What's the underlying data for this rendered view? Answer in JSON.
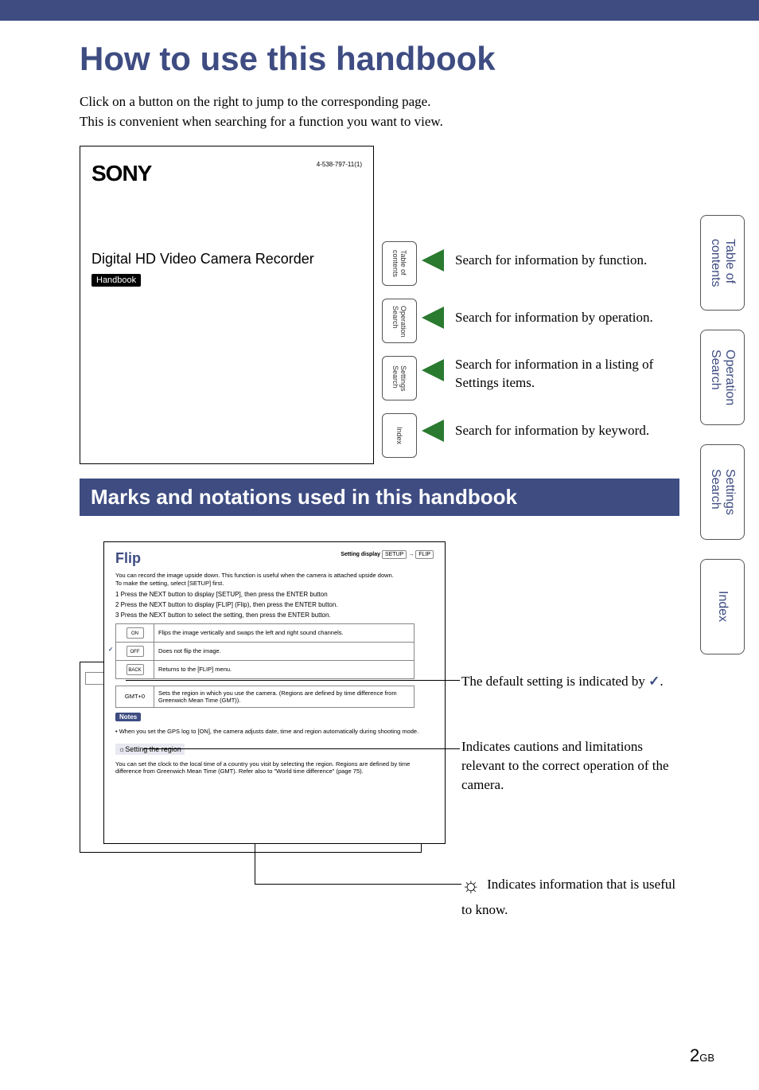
{
  "title": "How to use this handbook",
  "intro": "Click on a button on the right to jump to the corresponding page.\nThis is convenient when searching for a function you want to view.",
  "cover": {
    "brand": "SONY",
    "code": "4-538-797-11(1)",
    "product": "Digital HD Video Camera Recorder",
    "badge": "Handbook"
  },
  "side_tabs": {
    "toc": "Table of\ncontents",
    "op": "Operation\nSearch",
    "set": "Settings\nSearch",
    "idx": "Index"
  },
  "arrows": {
    "function": "Search for information by function.",
    "operation": "Search for information by operation.",
    "listing": "Search for information in a listing of Settings items.",
    "keyword": "Search for information by keyword."
  },
  "section2": "Marks and notations used in this handbook",
  "inner": {
    "flip": "Flip",
    "setting_display_label": "Setting display",
    "setup_box": "SETUP",
    "flip_box": "FLIP",
    "desc": "You can record the image upside down. This function is useful when the camera is attached upside down.\nTo make the setting, select [SETUP] first.",
    "step1": "1 Press the NEXT button to display [SETUP], then press the ENTER button",
    "step2": "2 Press the NEXT button to display [FLIP] (Flip), then press the ENTER button.",
    "step3": "3 Press the NEXT button to select the setting, then press the ENTER button.",
    "rows": [
      {
        "icon": "ON",
        "desc": "Flips the image vertically and swaps the left and right sound channels."
      },
      {
        "icon": "OFF",
        "desc": "Does not flip the image."
      },
      {
        "icon": "BACK",
        "desc": "Returns to the [FLIP] menu."
      }
    ],
    "gmt_row": {
      "label": "GMT+0",
      "desc": "Sets the region in which you use the camera. (Regions are defined by time difference from Greenwich Mean Time (GMT))."
    },
    "notes_label": "Notes",
    "notes_bullet": "• When you set the GPS log to [ON], the camera adjusts date, time and region automatically during shooting mode.",
    "tip_title": "Setting the region",
    "tip_body": "You can set the clock to the local time of a country you visit by selecting the region. Regions are defined by time difference from Greenwich Mean Time (GMT). Refer also to \"World time difference\" (page 75)."
  },
  "callouts": {
    "default": "The default setting is indicated by ",
    "default_suffix": ".",
    "cautions": "Indicates cautions and limitations relevant to the correct operation of the camera.",
    "useful": " Indicates information that is useful to know."
  },
  "right_tabs": {
    "toc": "Table of\ncontents",
    "op": "Operation\nSearch",
    "set": "Settings\nSearch",
    "idx": "Index"
  },
  "page": {
    "num": "2",
    "suffix": "GB"
  },
  "glyphs": {
    "check": "✓",
    "hint": "☼",
    "arrow": "→"
  }
}
